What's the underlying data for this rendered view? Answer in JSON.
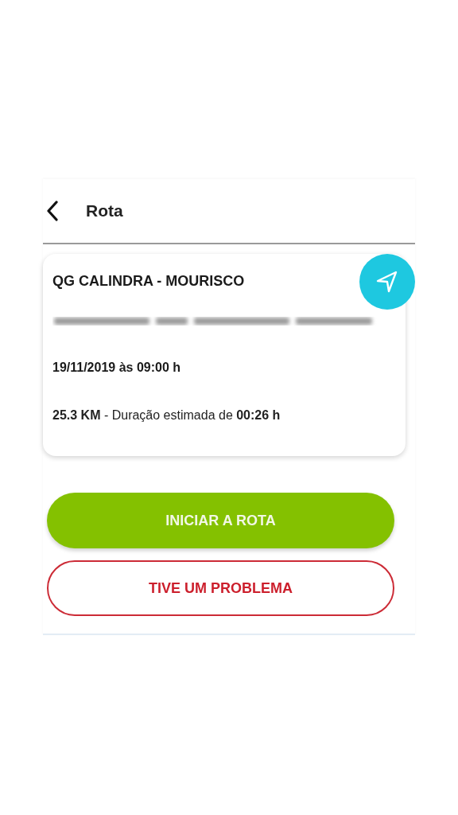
{
  "header": {
    "title": "Rota"
  },
  "route": {
    "name": "QG CALINDRA - MOURISCO",
    "datetime": "19/11/2019 às 09:00 h",
    "summary": "**25.3 KM** - Duração estimada de **00:26 h**"
  },
  "buttons": [
    {
      "label": "INICIAR A ROTA",
      "kind": "primary"
    },
    {
      "label": "TIVE UM PROBLEMA",
      "kind": "outline"
    }
  ]
}
